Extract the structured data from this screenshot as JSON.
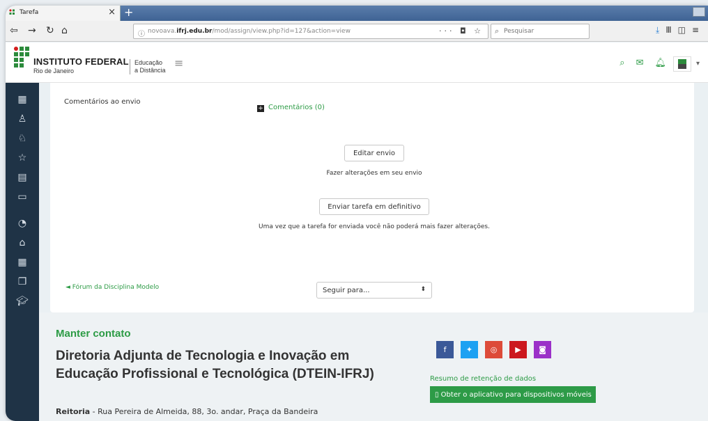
{
  "browser": {
    "tab_title": "Tarefa",
    "tab_close": "×",
    "new_tab": "+",
    "url_scheme_host_prefix": "novoava.",
    "url_host_bold": "ifrj.edu.br",
    "url_path": "/mod/assign/view.php?id=127&action=view",
    "url_actions": "··· ◘ ☆",
    "search_placeholder": "Pesquisar"
  },
  "header": {
    "institution": "INSTITUTO FEDERAL",
    "campus": "Rio de Janeiro",
    "unit_line1": "Educação",
    "unit_line2": "a Distância"
  },
  "main": {
    "comments_label": "Comentários ao envio",
    "comments_link": "Comentários (0)",
    "edit_button": "Editar envio",
    "edit_note": "Fazer alterações em seu envio",
    "submit_button": "Enviar tarefa em definitivo",
    "submit_note": "Uma vez que a tarefa for enviada você não poderá mais fazer alterações.",
    "prev_link": "◄ Fórum da Disciplina Modelo",
    "jump_select": "Seguir para..."
  },
  "footer": {
    "heading": "Manter contato",
    "org": "Diretoria Adjunta de Tecnologia e Inovação em Educação Profissional e Tecnológica (DTEIN-IFRJ)",
    "addr_bold": "Reitoria",
    "addr_rest": " - Rua Pereira de Almeida, 88, 3o. andar, Praça da Bandeira",
    "retention_link": "Resumo de retenção de dados",
    "app_button": "▯ Obter o aplicativo para dispositivos móveis"
  },
  "colors": {
    "accent_green": "#2c9b45",
    "sidebar": "#1f3346",
    "facebook": "#3b5998",
    "twitter": "#1da1f2",
    "google": "#dd4b39",
    "youtube": "#cc181e",
    "instagram": "#9b30c8"
  },
  "icons": {
    "sidebar": [
      "dashboard-icon",
      "participants-icon",
      "badges-icon",
      "competencies-icon",
      "grades-icon",
      "folder-icon",
      "dashboard-gauge-icon",
      "home-icon",
      "calendar-icon",
      "files-icon",
      "courses-icon"
    ],
    "header": [
      "search-icon",
      "mail-icon",
      "bell-icon"
    ],
    "social": [
      "facebook-icon",
      "twitter-icon",
      "google-plus-icon",
      "youtube-icon",
      "instagram-icon"
    ]
  }
}
